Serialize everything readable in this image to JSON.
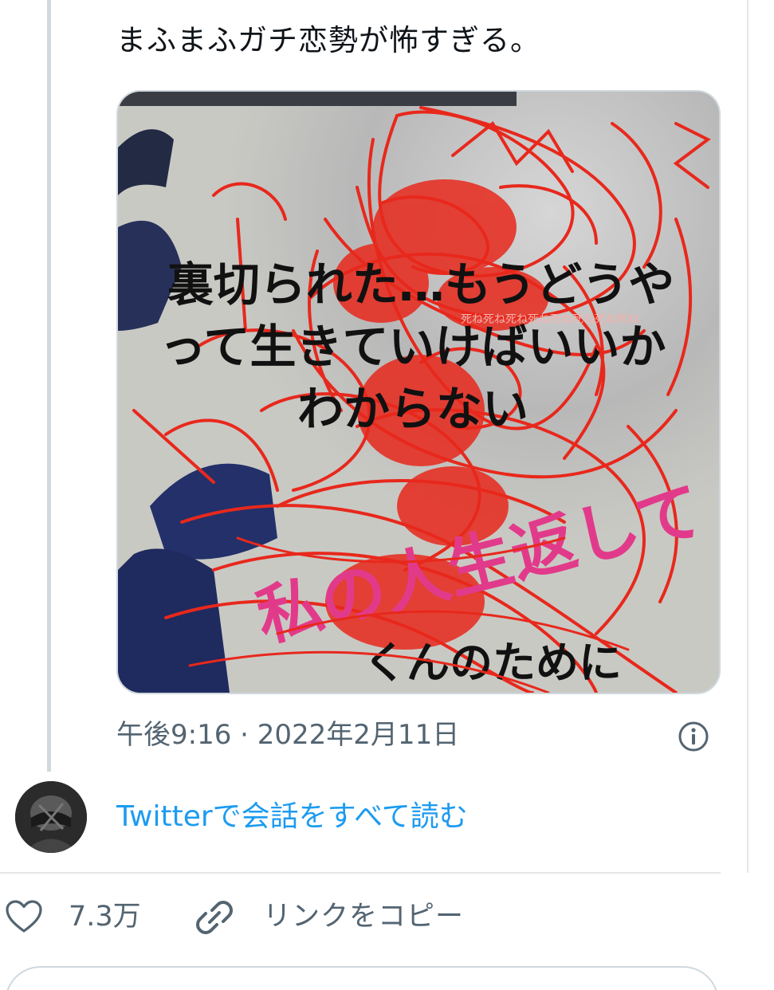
{
  "tweet": {
    "text": "まふまふガチ恋勢が怖すぎる。",
    "timestamp": "午後9:16 · 2022年2月11日",
    "media": {
      "line1": "裏切られた…もうどうや",
      "line2": "って生きていけばいいか",
      "line3": "わからない",
      "pink_text": "私の人生返して",
      "bottom_text": "くんのために"
    }
  },
  "conversation": {
    "read_link": "Twitterで会話をすべて読む"
  },
  "actions": {
    "like_count": "7.3万",
    "copy_link_label": "リンクをコピー"
  },
  "icons": {
    "info": "info-icon",
    "heart": "heart-icon",
    "link": "link-icon"
  },
  "colors": {
    "link_blue": "#1d9bf0",
    "secondary_text": "#536471",
    "scribble_red": "#e8281c",
    "pink_text": "#e23a8a"
  }
}
